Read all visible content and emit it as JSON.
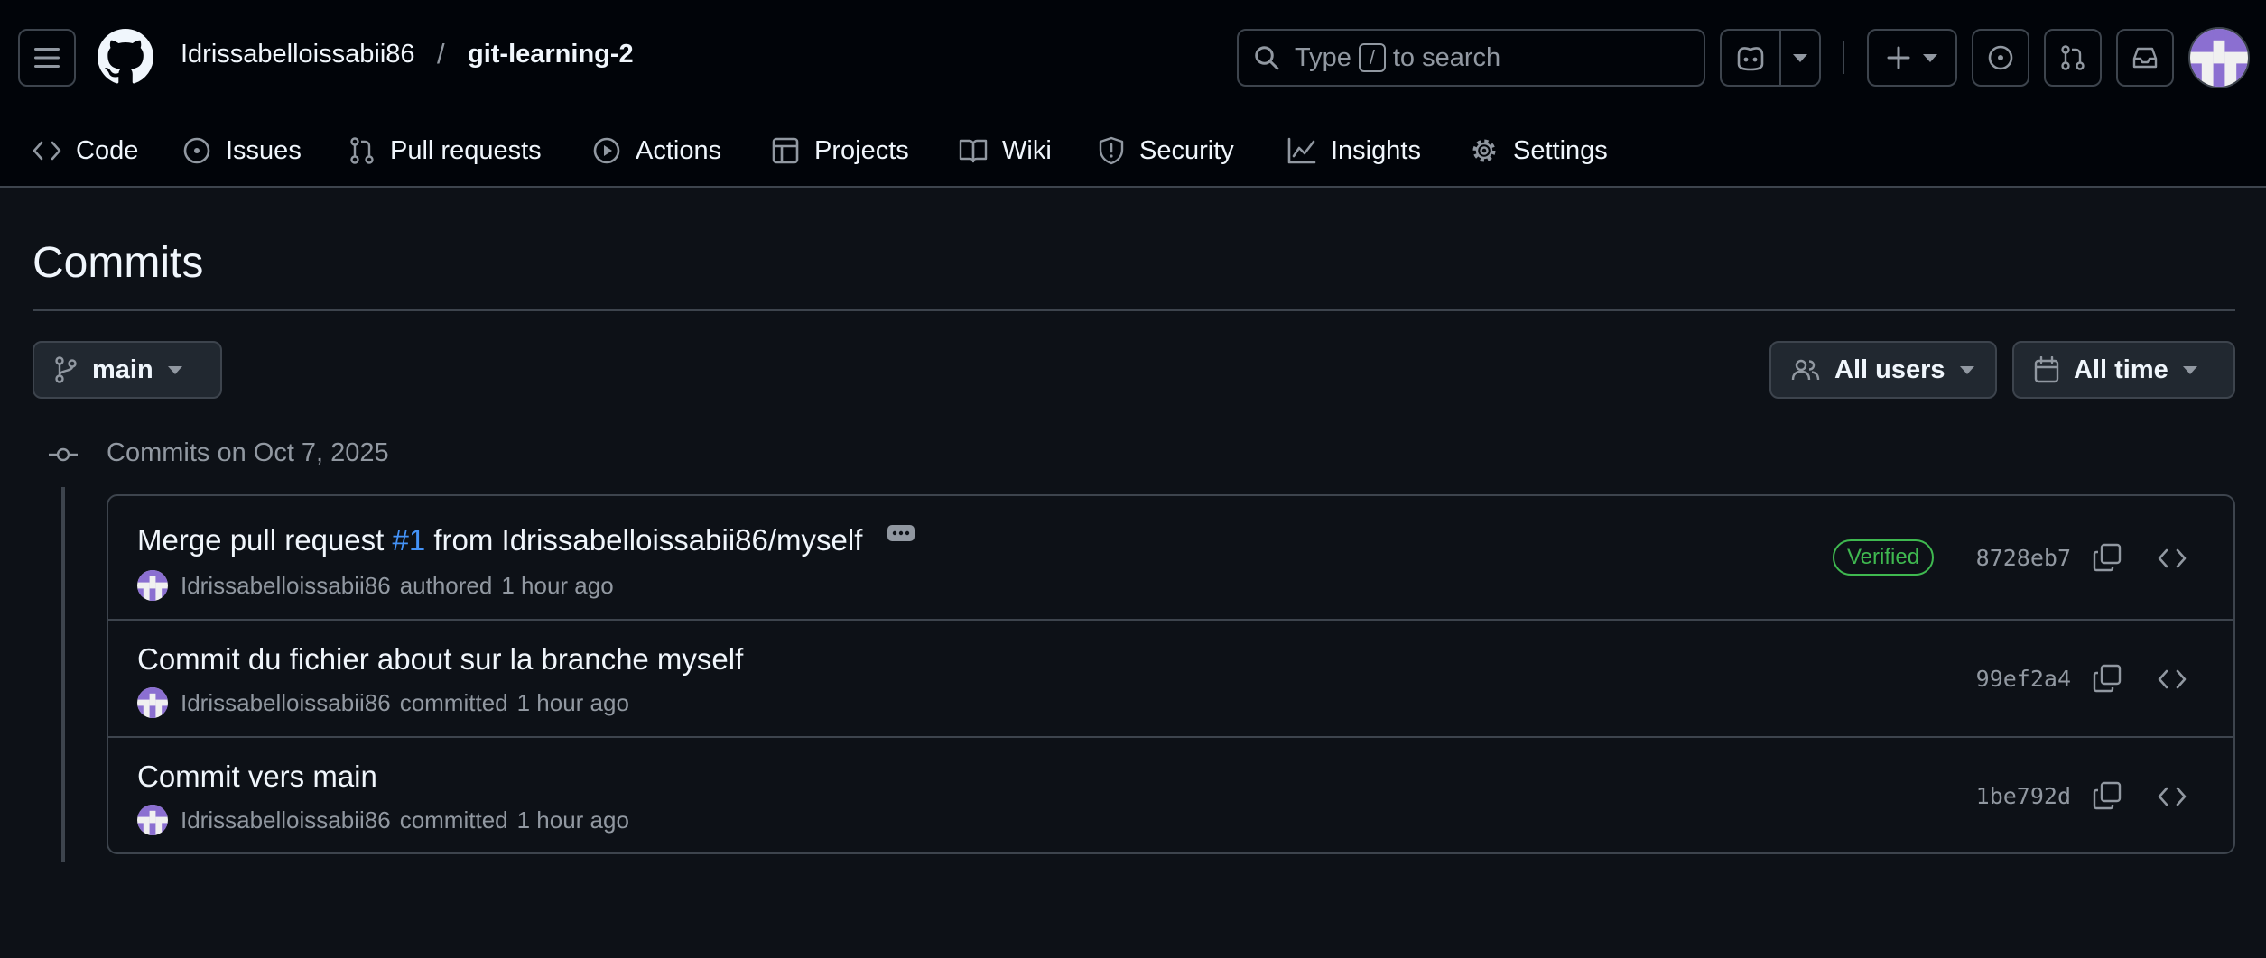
{
  "header": {
    "owner": "Idrissabelloissabii86",
    "separator": "/",
    "repo": "git-learning-2",
    "search_prefix": "Type",
    "search_key": "/",
    "search_suffix": "to search"
  },
  "nav": {
    "items": [
      {
        "label": "Code",
        "icon": "code-icon"
      },
      {
        "label": "Issues",
        "icon": "issue-icon"
      },
      {
        "label": "Pull requests",
        "icon": "pull-request-icon"
      },
      {
        "label": "Actions",
        "icon": "play-icon"
      },
      {
        "label": "Projects",
        "icon": "table-icon"
      },
      {
        "label": "Wiki",
        "icon": "book-icon"
      },
      {
        "label": "Security",
        "icon": "shield-icon"
      },
      {
        "label": "Insights",
        "icon": "graph-icon"
      },
      {
        "label": "Settings",
        "icon": "gear-icon"
      }
    ]
  },
  "page": {
    "title": "Commits",
    "branch": "main",
    "users_filter": "All users",
    "time_filter": "All time"
  },
  "groups": [
    {
      "heading": "Commits on Oct 7, 2025",
      "commits": [
        {
          "message_prefix": "Merge pull request ",
          "pr_link": "#1",
          "message_suffix": " from Idrissabelloissabii86/myself",
          "author": "Idrissabelloissabii86",
          "action": "authored",
          "time": "1 hour ago",
          "badge": "Verified",
          "sha": "8728eb7"
        },
        {
          "message": "Commit du fichier about sur la branche myself",
          "author": "Idrissabelloissabii86",
          "action": "committed",
          "time": "1 hour ago",
          "sha": "99ef2a4"
        },
        {
          "message": "Commit vers main",
          "author": "Idrissabelloissabii86",
          "action": "committed",
          "time": "1 hour ago",
          "sha": "1be792d"
        }
      ]
    }
  ],
  "colors": {
    "background": "#0d1117",
    "header_background": "#010409",
    "border": "#3d444d",
    "link": "#4493f8",
    "verified": "#3fb950",
    "muted": "#9198a1"
  }
}
